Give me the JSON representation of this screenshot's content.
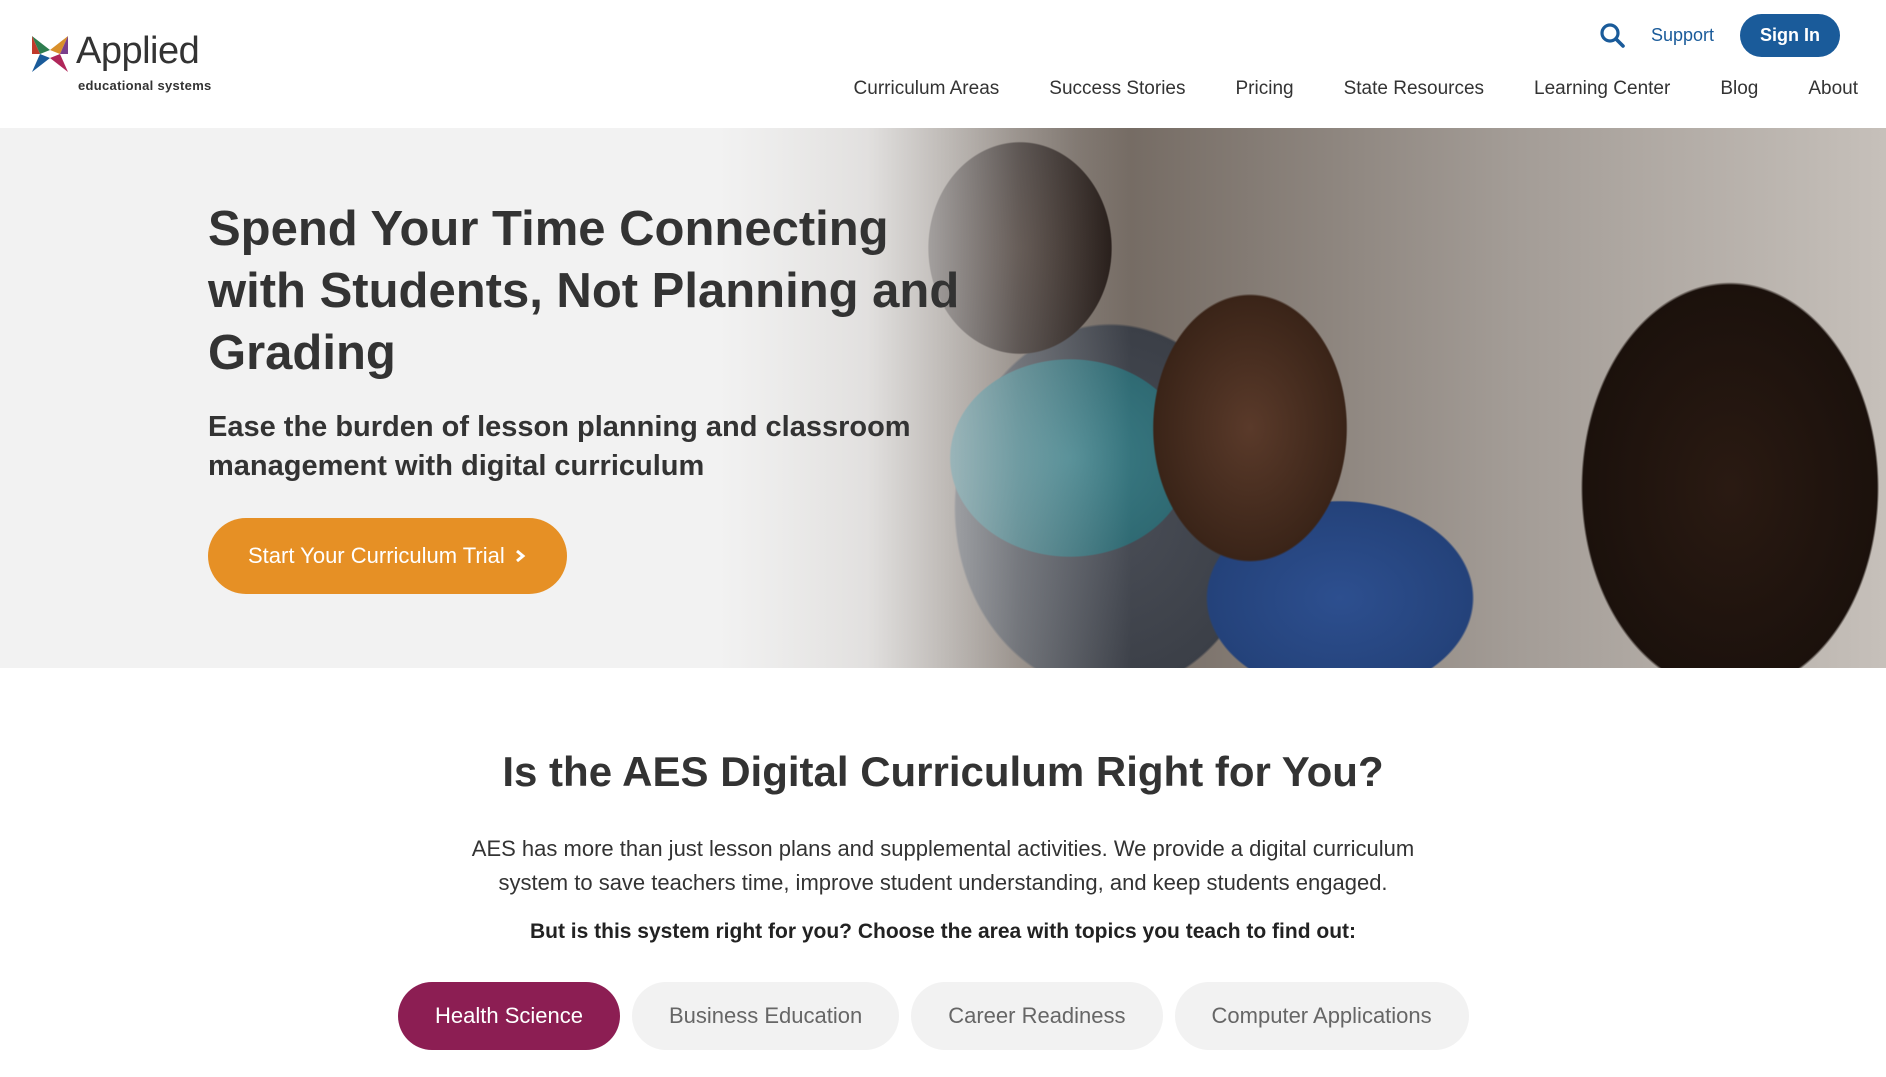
{
  "header": {
    "logo_word": "Applied",
    "logo_sub": "educational systems",
    "utility": {
      "support_label": "Support",
      "signin_label": "Sign In"
    },
    "nav": [
      "Curriculum Areas",
      "Success Stories",
      "Pricing",
      "State Resources",
      "Learning Center",
      "Blog",
      "About"
    ]
  },
  "hero": {
    "title": "Spend Your Time Connecting with Students, Not Planning and Grading",
    "subtitle": "Ease the burden of lesson planning and classroom management with digital curriculum",
    "cta_label": "Start Your Curriculum Trial"
  },
  "section": {
    "title": "Is the AES Digital Curriculum Right for You?",
    "paragraph": "AES has more than just lesson plans and supplemental activities. We provide a digital curriculum system to save teachers time, improve student understanding, and keep students engaged.",
    "question": "But is this system right for you? Choose the area with topics you teach to find out:",
    "tabs": [
      "Health Science",
      "Business Education",
      "Career Readiness",
      "Computer Applications"
    ],
    "active_tab": "Health Science"
  },
  "colors": {
    "brand_blue": "#1a5b9a",
    "cta_orange": "#e69025",
    "active_tab": "#8c1e53"
  }
}
